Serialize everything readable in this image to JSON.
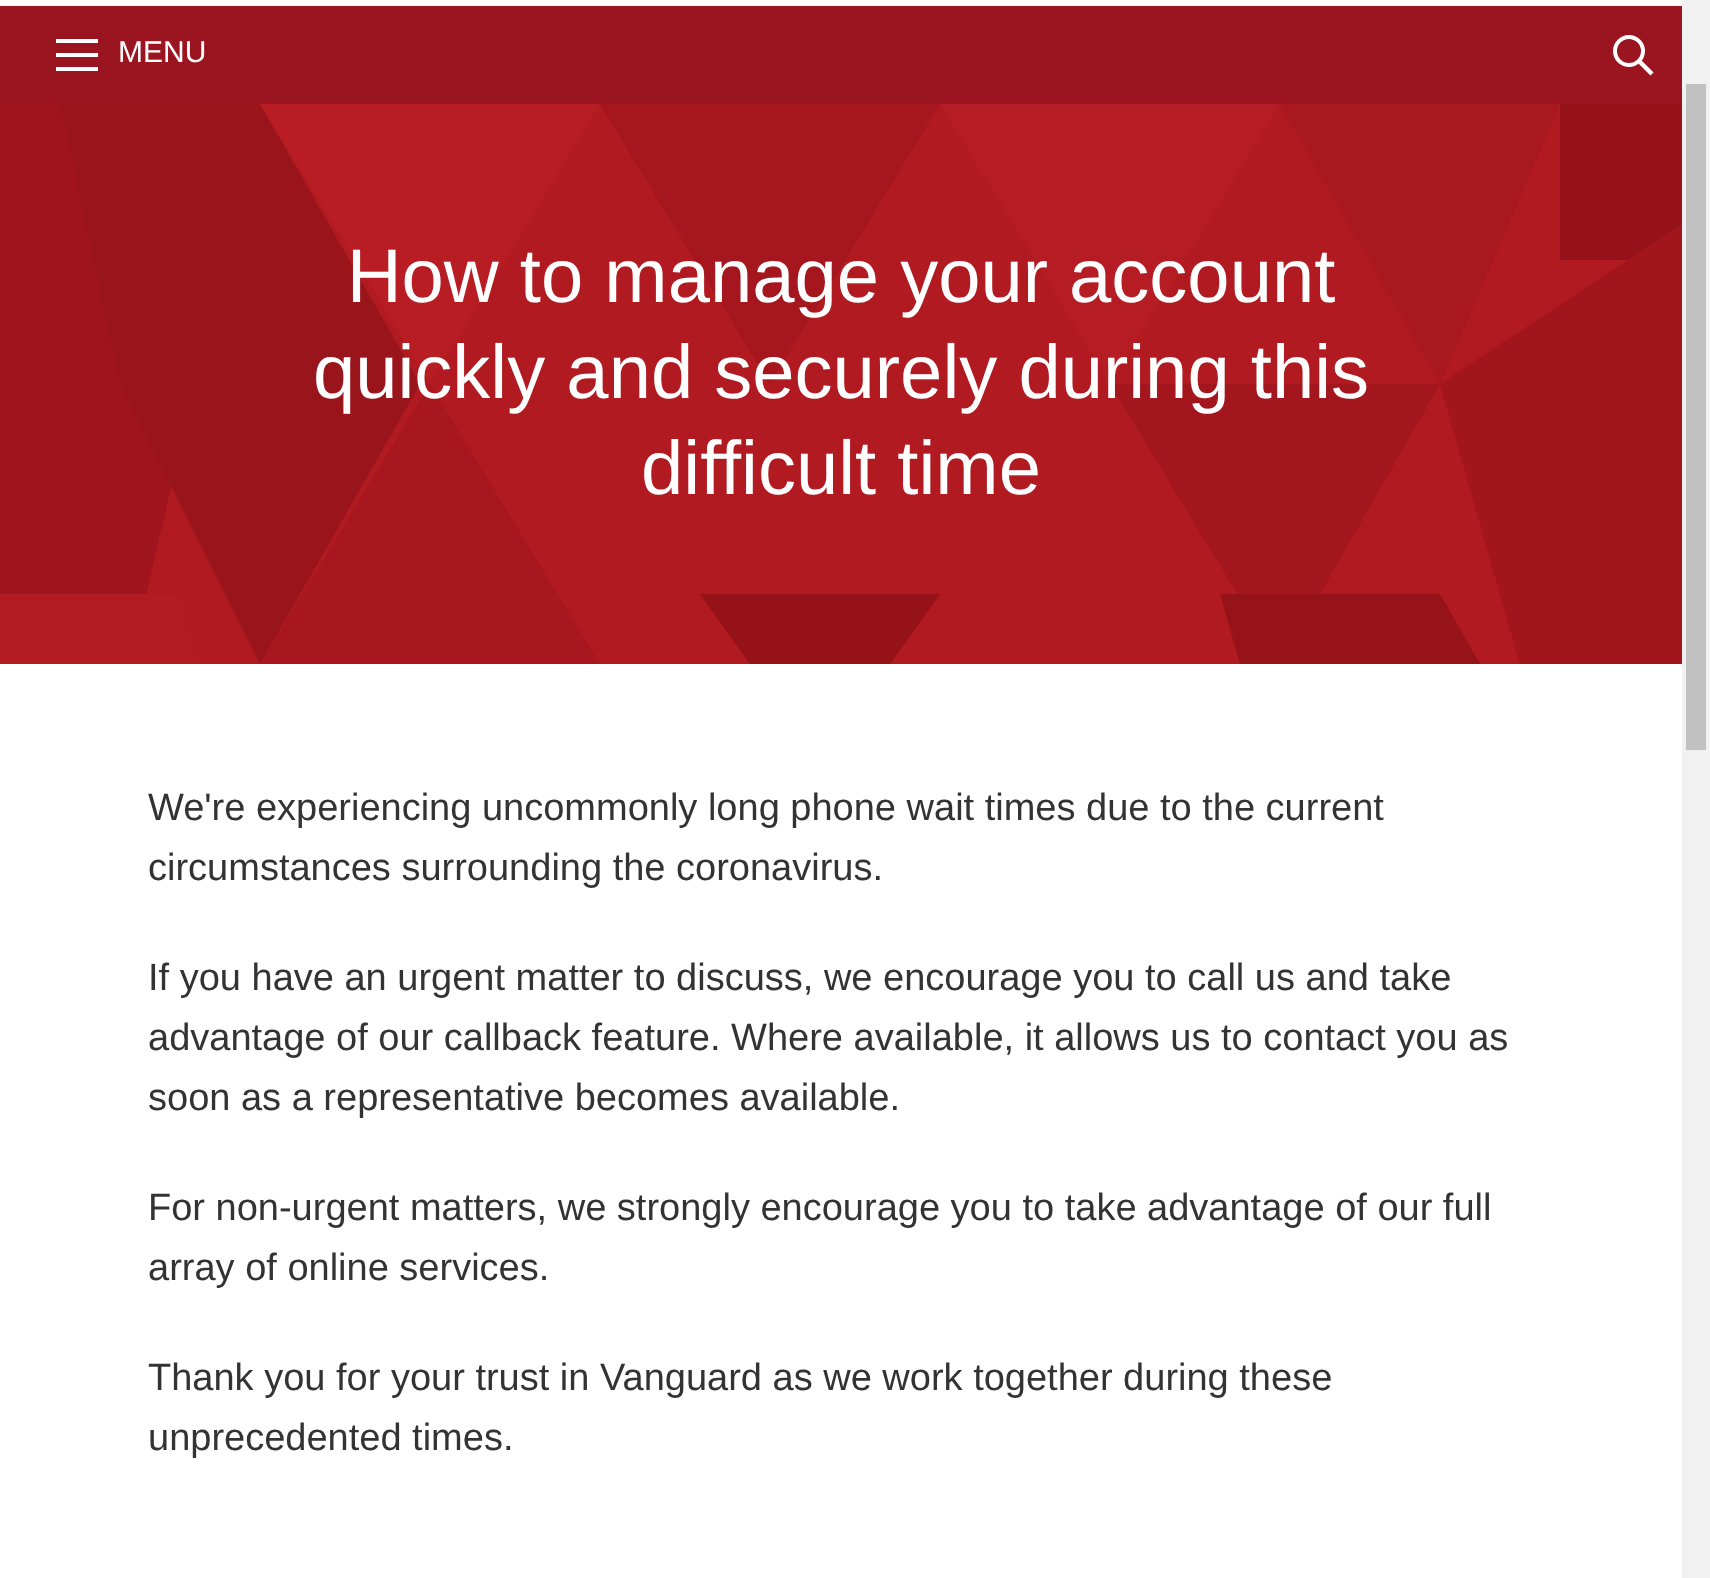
{
  "header": {
    "menu_label": "MENU"
  },
  "hero": {
    "title": "How to manage your account quickly and securely during this difficult time"
  },
  "paragraphs": [
    "We're experiencing uncommonly long phone wait times due to the current circumstances surrounding the coronavirus.",
    "If you have an urgent matter to discuss, we encourage you to call us and take advantage of our callback feature. Where available, it allows us to contact you as soon as a representative becomes available.",
    "For non-urgent matters, we strongly encourage you to take advantage of our full array of online services.",
    "Thank you for your trust in Vanguard as we work together during these unprecedented times."
  ]
}
